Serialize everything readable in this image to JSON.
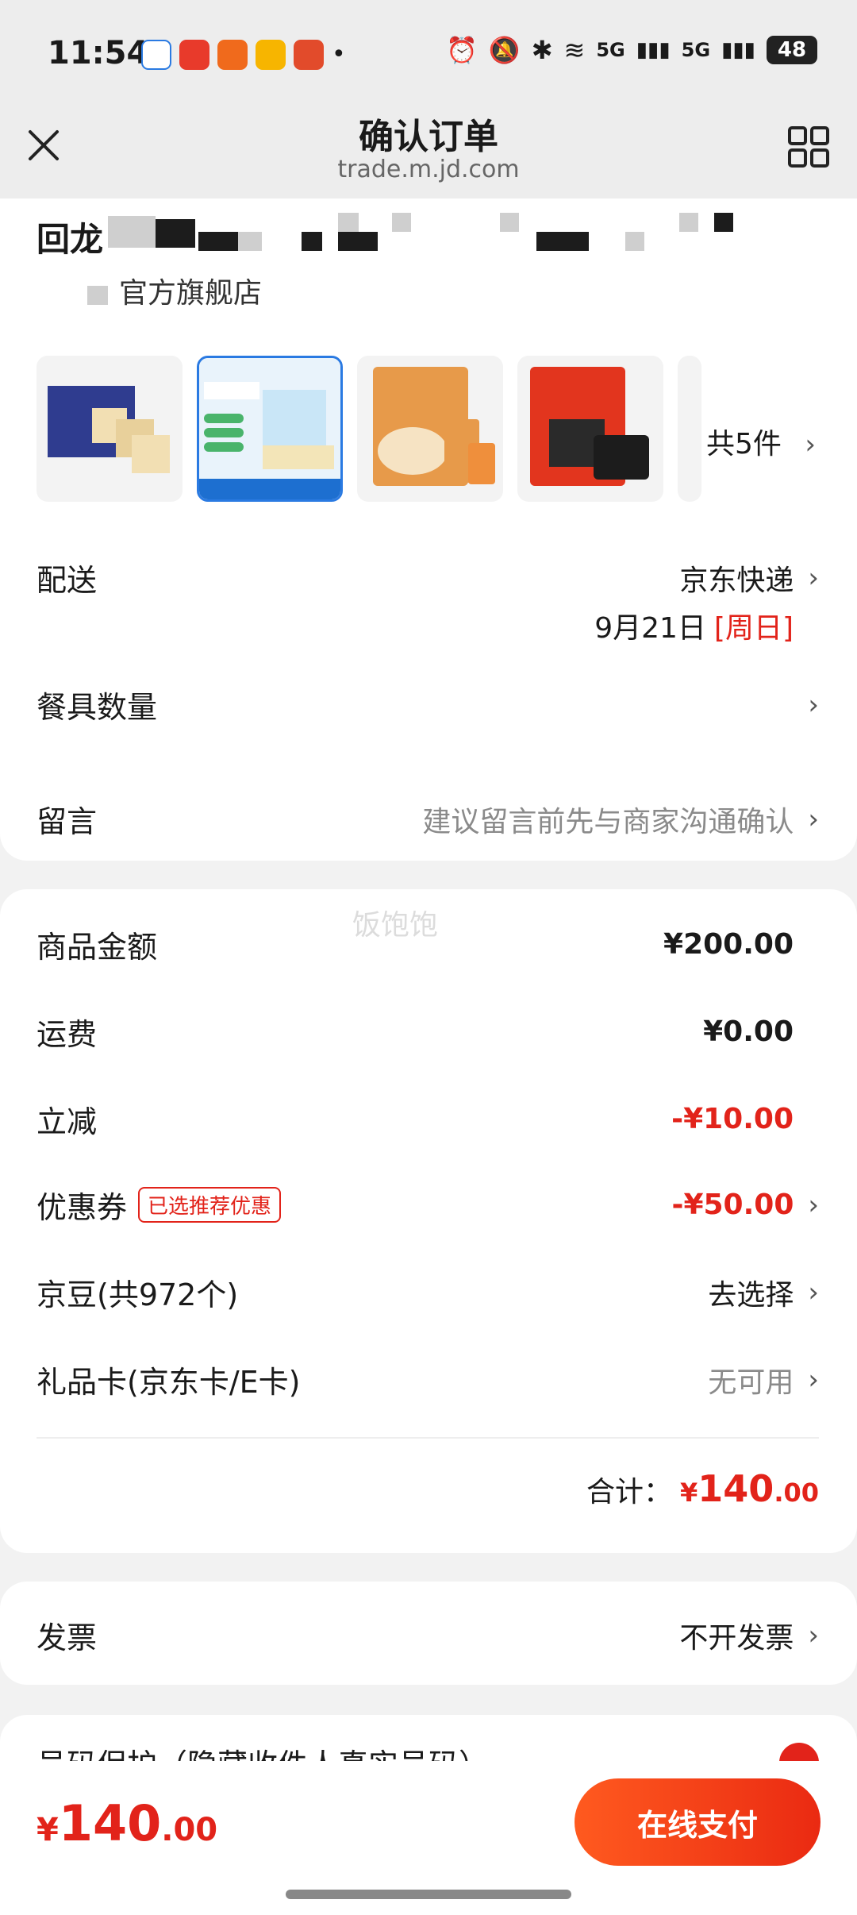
{
  "status_bar": {
    "time": "11:54",
    "battery": "48",
    "network": "5G"
  },
  "header": {
    "title": "确认订单",
    "url": "trade.m.jd.com",
    "close_icon": "close-icon",
    "menu_icon": "grid-icon"
  },
  "store": {
    "address_prefix": "回龙",
    "shop_suffix": "官方旗舰店",
    "items_count_label": "共5件"
  },
  "products": [
    {
      "name": "product-crackers"
    },
    {
      "name": "product-cheese-sticks"
    },
    {
      "name": "product-wafers"
    },
    {
      "name": "product-seaweed"
    }
  ],
  "delivery": {
    "label": "配送",
    "method": "京东快递",
    "date": "9月21日",
    "weekday": "[周日]"
  },
  "tableware": {
    "label": "餐具数量"
  },
  "message": {
    "label": "留言",
    "placeholder": "建议留言前先与商家沟通确认"
  },
  "watermark": "饭饱饱",
  "price": {
    "goods_label": "商品金额",
    "goods_value": "¥200.00",
    "shipping_label": "运费",
    "shipping_value": "¥0.00",
    "discount_label": "立减",
    "discount_value": "-¥10.00",
    "coupon_label": "优惠券",
    "coupon_tag": "已选推荐优惠",
    "coupon_value": "-¥50.00",
    "beans_label": "京豆(共972个)",
    "beans_value": "去选择",
    "giftcard_label": "礼品卡(京东卡/E卡)",
    "giftcard_value": "无可用",
    "total_label": "合计：",
    "total_symbol": "¥",
    "total_int": "140",
    "total_dec": ".00"
  },
  "invoice": {
    "label": "发票",
    "value": "不开发票"
  },
  "privacy": {
    "label": "号码保护（隐藏收件人真实号码）"
  },
  "bottom": {
    "symbol": "¥",
    "amount_int": "140",
    "amount_dec": ".00",
    "pay_label": "在线支付"
  },
  "colors": {
    "accent": "#e2231a",
    "pay_gradient_start": "#ff5a1f",
    "pay_gradient_end": "#ea2a12"
  }
}
